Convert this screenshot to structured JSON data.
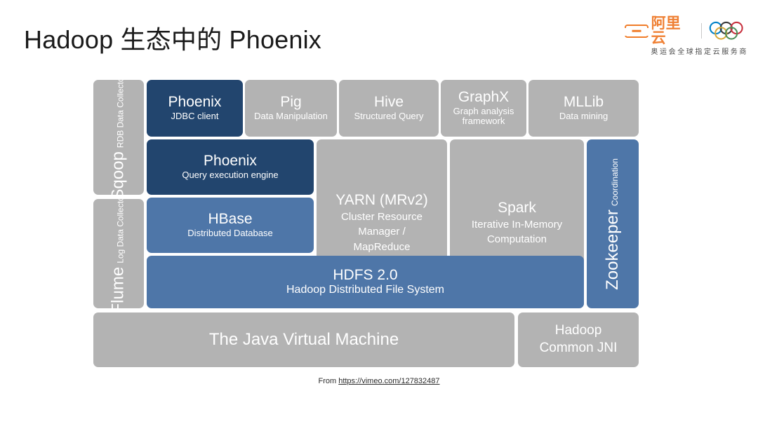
{
  "page_title": "Hadoop 生态中的 Phoenix",
  "logo": {
    "brand_text": "阿里云",
    "brand_icon": "alibaba-cloud-bracket-icon",
    "rings_icon": "olympic-rings-icon",
    "tagline": "奥运会全球指定云服务商",
    "brand_color": "#ef8034",
    "ring_colors": [
      "#0081c8",
      "#000000",
      "#ee334e",
      "#fcb131",
      "#00a651"
    ]
  },
  "colors": {
    "gray": "#b3b3b3",
    "blue": "#4e76a8",
    "navy": "#22456e",
    "background": "#ffffff"
  },
  "diagram": {
    "name": "hadoop-ecosystem-stack",
    "side_left": [
      {
        "key": "sqoop",
        "title": "Sqoop",
        "subtitle": "RDB Data Collector",
        "color": "gray"
      },
      {
        "key": "flume",
        "title": "Flume",
        "subtitle": "Log Data Collector",
        "color": "gray"
      }
    ],
    "side_right": [
      {
        "key": "zookeeper",
        "title": "Zookeeper",
        "subtitle": "Coordination",
        "color": "blue"
      }
    ],
    "row_tools": [
      {
        "key": "phoenix-jdbc",
        "title": "Phoenix",
        "subtitle": "JDBC client",
        "color": "navy"
      },
      {
        "key": "pig",
        "title": "Pig",
        "subtitle": "Data Manipulation",
        "color": "gray"
      },
      {
        "key": "hive",
        "title": "Hive",
        "subtitle": "Structured Query",
        "color": "gray"
      },
      {
        "key": "graphx",
        "title": "GraphX",
        "subtitle": "Graph analysis framework",
        "color": "gray"
      },
      {
        "key": "mllib",
        "title": "MLLib",
        "subtitle": "Data mining",
        "color": "gray"
      }
    ],
    "row_engines": [
      {
        "key": "phoenix-engine",
        "title": "Phoenix",
        "subtitle": "Query execution engine",
        "color": "navy"
      },
      {
        "key": "yarn",
        "title": "YARN (MRv2)",
        "subtitle": "Cluster Resource Manager / MapReduce",
        "color": "gray"
      },
      {
        "key": "spark",
        "title": "Spark",
        "subtitle": "Iterative In-Memory Computation",
        "color": "gray"
      }
    ],
    "row_storage": [
      {
        "key": "hbase",
        "title": "HBase",
        "subtitle": "Distributed Database",
        "color": "blue"
      }
    ],
    "row_fs": [
      {
        "key": "hdfs",
        "title": "HDFS 2.0",
        "subtitle": "Hadoop Distributed File System",
        "color": "blue"
      }
    ],
    "row_base": [
      {
        "key": "jvm",
        "title": "The Java Virtual Machine",
        "subtitle": "",
        "color": "gray"
      },
      {
        "key": "hadoop-common-jni",
        "title": "Hadoop",
        "subtitle": "Common JNI",
        "color": "gray"
      }
    ]
  },
  "source": {
    "prefix": "From ",
    "link_text": "https://vimeo.com/127832487"
  }
}
